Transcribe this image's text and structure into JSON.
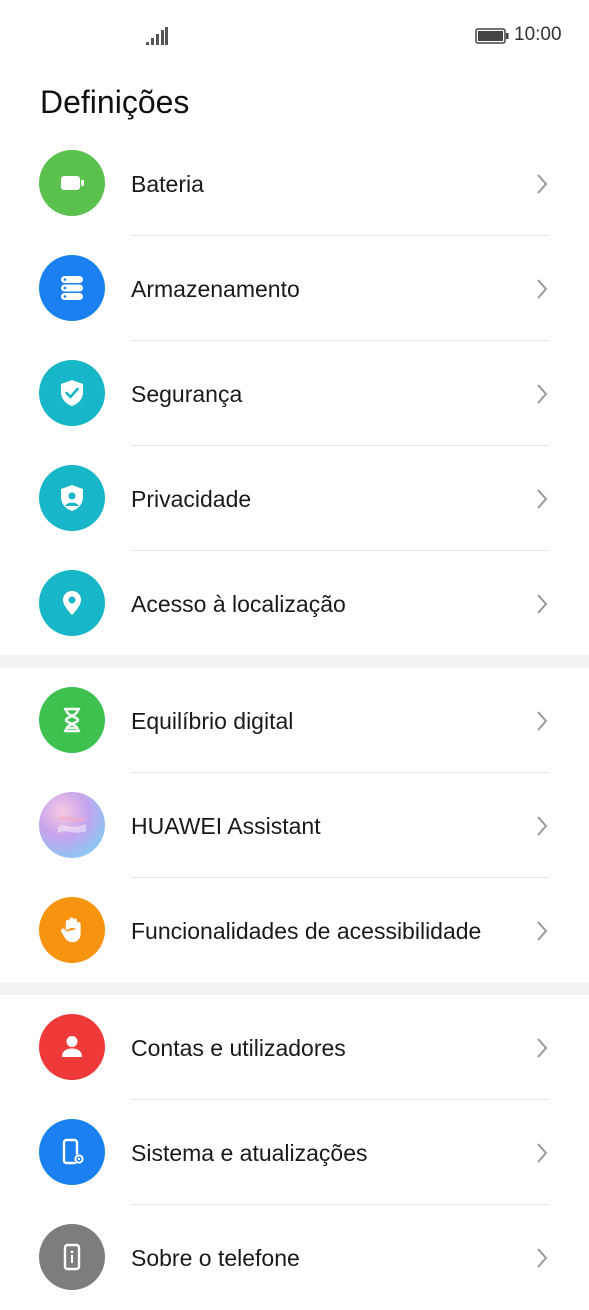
{
  "status": {
    "time": "10:00"
  },
  "header": {
    "title": "Definições"
  },
  "groups": [
    {
      "items": [
        {
          "label": "Bateria",
          "icon": "battery-icon",
          "color": "#5bc14f"
        },
        {
          "label": "Armazenamento",
          "icon": "storage-icon",
          "color": "#1a7ff0"
        },
        {
          "label": "Segurança",
          "icon": "shield-check-icon",
          "color": "#17b6c9"
        },
        {
          "label": "Privacidade",
          "icon": "privacy-icon",
          "color": "#17b6c9"
        },
        {
          "label": "Acesso à localização",
          "icon": "location-pin-icon",
          "color": "#17b6c9"
        }
      ]
    },
    {
      "items": [
        {
          "label": "Equilíbrio digital",
          "icon": "hourglass-icon",
          "color": "#3fc14f"
        },
        {
          "label": "HUAWEI Assistant",
          "icon": "huawei-assistant-icon",
          "color": "#c9a6e8"
        },
        {
          "label": "Funcionalidades de acessibilidade",
          "icon": "hand-icon",
          "color": "#f7930f"
        }
      ]
    },
    {
      "items": [
        {
          "label": "Contas e utilizadores",
          "icon": "user-icon",
          "color": "#f03a3a"
        },
        {
          "label": "Sistema e atualizações",
          "icon": "phone-settings-icon",
          "color": "#1a7ff0"
        },
        {
          "label": "Sobre o telefone",
          "icon": "phone-info-icon",
          "color": "#7d7d7d"
        }
      ]
    }
  ]
}
